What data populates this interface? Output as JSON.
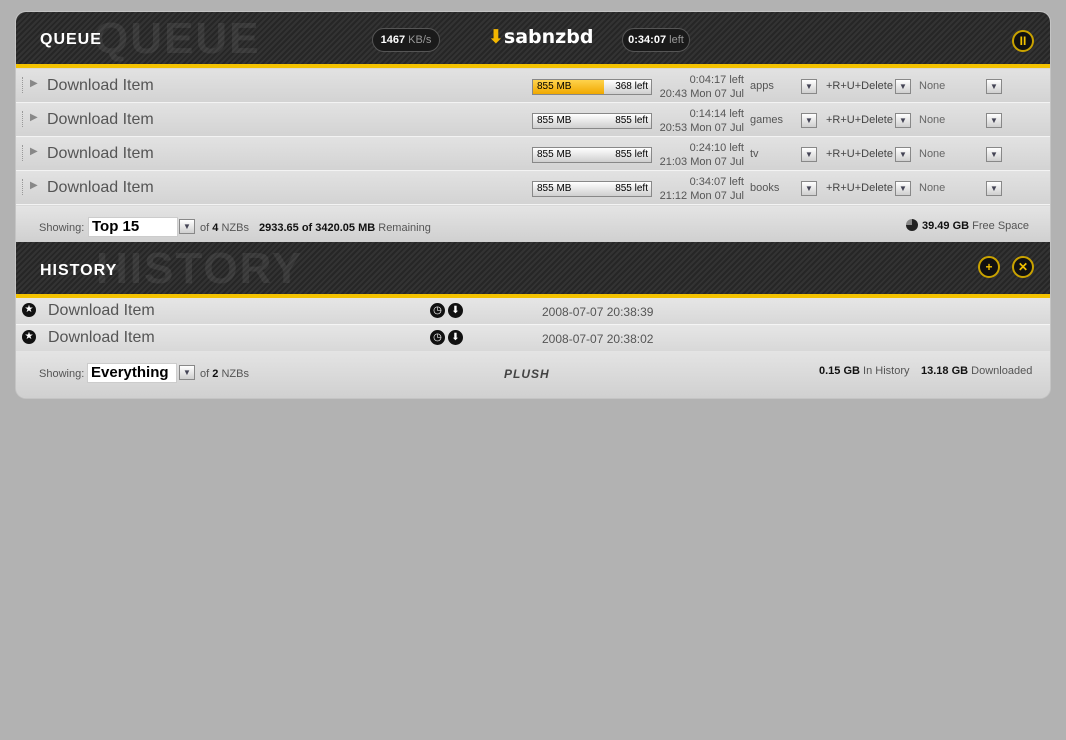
{
  "queue": {
    "title": "QUEUE",
    "speed_value": "1467",
    "speed_unit": "KB/s",
    "logo": "sabnzbd",
    "time_value": "0:34:07",
    "time_unit": "left",
    "pause_label": "II",
    "items": [
      {
        "name": "Download Item",
        "size": "855 MB",
        "left": "368 left",
        "progress": 0.6,
        "eta": "0:04:17 left",
        "finish": "20:43 Mon 07 Jul",
        "category": "apps",
        "pp": "+R+U+Delete",
        "script": "None"
      },
      {
        "name": "Download Item",
        "size": "855 MB",
        "left": "855 left",
        "progress": 0,
        "eta": "0:14:14 left",
        "finish": "20:53 Mon 07 Jul",
        "category": "games",
        "pp": "+R+U+Delete",
        "script": "None"
      },
      {
        "name": "Download Item",
        "size": "855 MB",
        "left": "855 left",
        "progress": 0,
        "eta": "0:24:10 left",
        "finish": "21:03 Mon 07 Jul",
        "category": "tv",
        "pp": "+R+U+Delete",
        "script": "None"
      },
      {
        "name": "Download Item",
        "size": "855 MB",
        "left": "855 left",
        "progress": 0,
        "eta": "0:34:07 left",
        "finish": "21:12 Mon 07 Jul",
        "category": "books",
        "pp": "+R+U+Delete",
        "script": "None"
      }
    ],
    "footer": {
      "showing_label": "Showing:",
      "showing_value": "Top 15",
      "of_label": "of",
      "count": "4",
      "count_unit": "NZBs",
      "remaining_value": "2933.65 of 3420.05 MB",
      "remaining_label": "Remaining",
      "free_value": "39.49 GB",
      "free_label": "Free Space"
    }
  },
  "history": {
    "title": "HISTORY",
    "add_label": "+",
    "close_label": "✕",
    "items": [
      {
        "name": "Download Item",
        "date": "2008-07-07 20:38:39"
      },
      {
        "name": "Download Item",
        "date": "2008-07-07 20:38:02"
      }
    ],
    "footer": {
      "showing_label": "Showing:",
      "showing_value": "Everything",
      "of_label": "of",
      "count": "2",
      "count_unit": "NZBs",
      "brand": "PLUSH",
      "history_size": "0.15 GB",
      "history_label": "In History",
      "downloaded_size": "13.18 GB",
      "downloaded_label": "Downloaded"
    }
  },
  "icons": {
    "expand": "triangle-right-icon",
    "dropdown": "chevron-down-icon",
    "clock": "clock-icon",
    "download": "download-arrow-icon",
    "star": "star-icon",
    "disk": "disk-pie-icon"
  }
}
